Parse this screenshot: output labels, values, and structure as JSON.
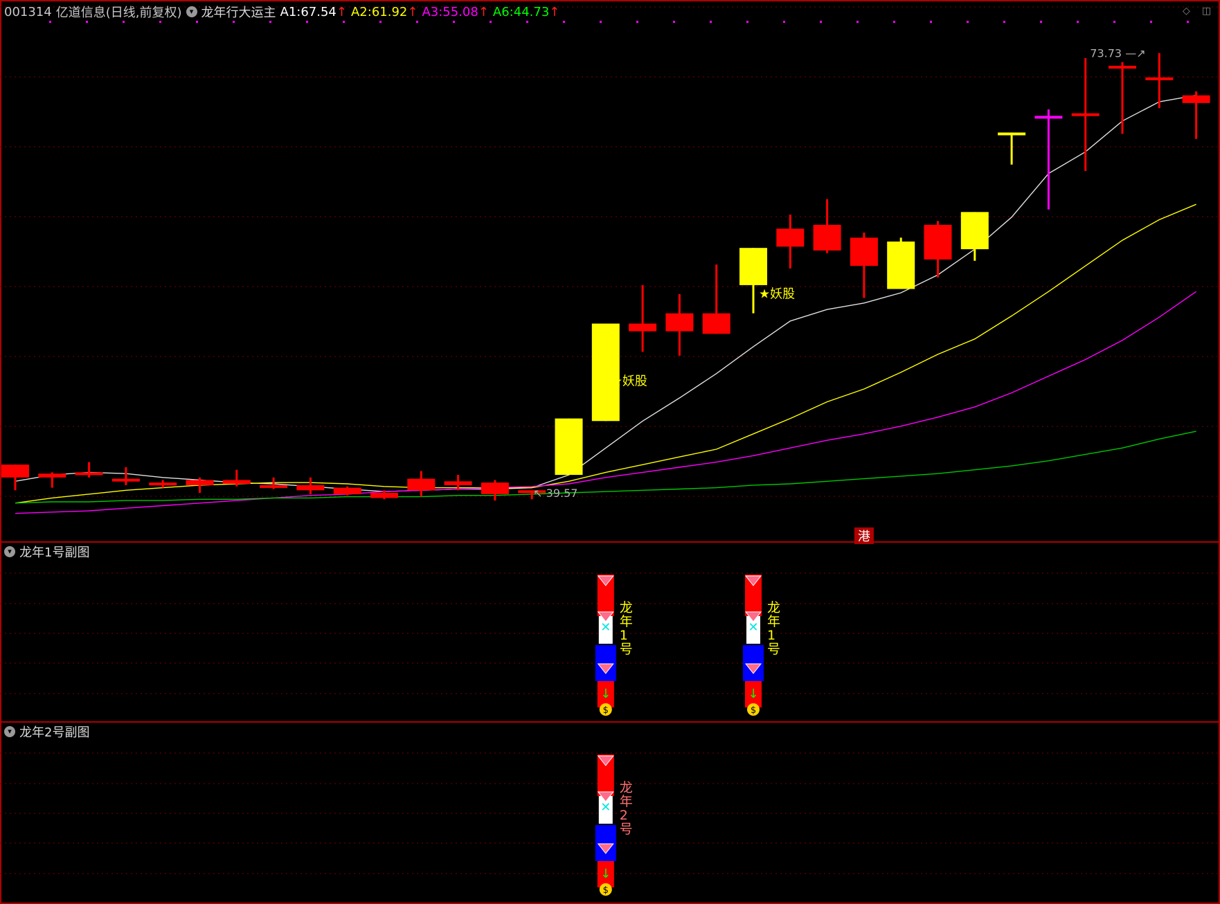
{
  "header": {
    "code": "001314",
    "name": "亿道信息(日线,前复权)",
    "indicator": "龙年行大运主",
    "ma_labels": [
      {
        "label": "A1:",
        "value": "67.54",
        "color": "#ffffff"
      },
      {
        "label": "A2:",
        "value": "61.92",
        "color": "#ffff00"
      },
      {
        "label": "A3:",
        "value": "55.08",
        "color": "#ff00ff"
      },
      {
        "label": "A6:",
        "value": "44.73",
        "color": "#00ff00"
      }
    ],
    "up_arrow": "↑"
  },
  "panes": {
    "sub1_title": "龙年1号副图",
    "sub2_title": "龙年2号副图",
    "sub1_glyphs": [
      "龙",
      "年",
      "1",
      "号"
    ],
    "sub2_glyphs": [
      "龙",
      "年",
      "2",
      "号"
    ]
  },
  "icons": [
    "chevron-down-icon",
    "diamond-icon",
    "window-icon",
    "gem-icon",
    "butterfly-icon",
    "arrow-down-icon",
    "money-bag-icon",
    "star-icon"
  ],
  "colors": {
    "up": "#ff0000",
    "down_yellow": "#ffff00",
    "magenta": "#ff00ff",
    "ma1": "#e0e0e0",
    "ma2": "#ffff00",
    "ma3": "#ff00ff",
    "ma6": "#00c800",
    "grid": "#7a0000",
    "frame": "#b00000",
    "sub_blue": "#0000ff"
  },
  "chart_data": {
    "type": "candlestick",
    "y_range_approx": [
      36,
      76
    ],
    "candles": [
      {
        "o": 40.6,
        "h": 41.2,
        "l": 39.6,
        "c": 41.6,
        "color": "red"
      },
      {
        "o": 40.9,
        "h": 41.0,
        "l": 39.8,
        "c": 40.6,
        "color": "red"
      },
      {
        "o": 41.0,
        "h": 41.8,
        "l": 40.6,
        "c": 40.8,
        "color": "red"
      },
      {
        "o": 40.5,
        "h": 41.4,
        "l": 40.0,
        "c": 40.3,
        "color": "red"
      },
      {
        "o": 40.2,
        "h": 40.4,
        "l": 39.8,
        "c": 40.0,
        "color": "red"
      },
      {
        "o": 40.4,
        "h": 40.6,
        "l": 39.4,
        "c": 40.0,
        "color": "red"
      },
      {
        "o": 40.4,
        "h": 41.2,
        "l": 39.9,
        "c": 40.1,
        "color": "red"
      },
      {
        "o": 40.0,
        "h": 40.6,
        "l": 39.7,
        "c": 39.8,
        "color": "red"
      },
      {
        "o": 40.0,
        "h": 40.6,
        "l": 39.3,
        "c": 39.6,
        "color": "red"
      },
      {
        "o": 39.8,
        "h": 39.9,
        "l": 39.2,
        "c": 39.3,
        "color": "red"
      },
      {
        "o": 39.4,
        "h": 39.6,
        "l": 38.9,
        "c": 39.0,
        "color": "red"
      },
      {
        "o": 39.6,
        "h": 41.1,
        "l": 39.1,
        "c": 40.5,
        "color": "red"
      },
      {
        "o": 40.0,
        "h": 40.8,
        "l": 39.6,
        "c": 40.3,
        "color": "red"
      },
      {
        "o": 40.2,
        "h": 40.4,
        "l": 38.8,
        "c": 39.3,
        "color": "red"
      },
      {
        "o": 39.5,
        "h": 39.6,
        "l": 38.9,
        "c": 39.6,
        "color": "red"
      },
      {
        "o": 40.8,
        "h": 45.2,
        "l": 40.8,
        "c": 45.2,
        "color": "yellow"
      },
      {
        "o": 45.0,
        "h": 52.6,
        "l": 45.0,
        "c": 52.6,
        "color": "yellow"
      },
      {
        "o": 52.6,
        "h": 55.6,
        "l": 50.4,
        "c": 52.0,
        "color": "red"
      },
      {
        "o": 53.4,
        "h": 54.9,
        "l": 50.1,
        "c": 52.0,
        "color": "red"
      },
      {
        "o": 53.4,
        "h": 57.2,
        "l": 51.8,
        "c": 51.8,
        "color": "red"
      },
      {
        "o": 55.6,
        "h": 56.7,
        "l": 53.4,
        "c": 58.5,
        "color": "yellow"
      },
      {
        "o": 60.0,
        "h": 61.1,
        "l": 56.9,
        "c": 58.6,
        "color": "red"
      },
      {
        "o": 60.3,
        "h": 62.3,
        "l": 58.1,
        "c": 58.3,
        "color": "red"
      },
      {
        "o": 57.1,
        "h": 59.7,
        "l": 54.6,
        "c": 59.3,
        "color": "red"
      },
      {
        "o": 59.0,
        "h": 59.3,
        "l": 55.3,
        "c": 55.3,
        "color": "yellow"
      },
      {
        "o": 57.6,
        "h": 60.6,
        "l": 56.2,
        "c": 60.3,
        "color": "red"
      },
      {
        "o": 58.4,
        "h": 58.0,
        "l": 57.5,
        "c": 61.3,
        "color": "yellow"
      },
      {
        "o": 67.5,
        "h": 66.9,
        "l": 65.0,
        "c": 67.5,
        "color": "yellow"
      },
      {
        "o": 68.8,
        "h": 69.3,
        "l": 61.5,
        "c": 68.6,
        "color": "magenta"
      },
      {
        "o": 69.0,
        "h": 73.3,
        "l": 64.5,
        "c": 69.0,
        "color": "red"
      },
      {
        "o": 72.7,
        "h": 73.0,
        "l": 67.4,
        "c": 72.7,
        "color": "red"
      },
      {
        "o": 71.8,
        "h": 73.7,
        "l": 69.4,
        "c": 71.8,
        "color": "red"
      },
      {
        "o": 69.8,
        "h": 70.7,
        "l": 67.0,
        "c": 70.4,
        "color": "red"
      }
    ],
    "ma_series": [
      {
        "name": "A1",
        "color": "#e0e0e0",
        "values": [
          40.3,
          40.8,
          41.0,
          40.9,
          40.6,
          40.4,
          40.2,
          40.1,
          39.9,
          39.7,
          39.5,
          39.6,
          39.7,
          39.7,
          39.8,
          40.8,
          42.9,
          45.0,
          46.8,
          48.7,
          50.8,
          52.8,
          53.7,
          54.2,
          55.0,
          56.4,
          58.4,
          60.9,
          64.3,
          66.0,
          68.4,
          69.9,
          70.4
        ]
      },
      {
        "name": "A2",
        "color": "#ffff00",
        "values": [
          38.6,
          39.0,
          39.3,
          39.6,
          39.8,
          40.0,
          40.1,
          40.2,
          40.2,
          40.1,
          39.9,
          39.8,
          39.8,
          39.8,
          39.8,
          40.3,
          41.0,
          41.6,
          42.2,
          42.8,
          44.0,
          45.2,
          46.5,
          47.5,
          48.8,
          50.2,
          51.4,
          53.2,
          55.1,
          57.1,
          59.1,
          60.7,
          61.9
        ]
      },
      {
        "name": "A3",
        "color": "#ff00ff",
        "values": [
          37.8,
          37.9,
          38.0,
          38.2,
          38.4,
          38.6,
          38.8,
          39.0,
          39.2,
          39.3,
          39.5,
          39.6,
          39.7,
          39.8,
          39.9,
          40.1,
          40.6,
          41.0,
          41.4,
          41.8,
          42.3,
          42.9,
          43.5,
          44.0,
          44.6,
          45.3,
          46.1,
          47.2,
          48.5,
          49.8,
          51.3,
          53.1,
          55.1
        ]
      },
      {
        "name": "A6",
        "color": "#00c800",
        "values": [
          38.6,
          38.7,
          38.7,
          38.8,
          38.8,
          38.9,
          38.9,
          39.0,
          39.0,
          39.1,
          39.1,
          39.1,
          39.2,
          39.2,
          39.3,
          39.4,
          39.5,
          39.6,
          39.7,
          39.8,
          40.0,
          40.1,
          40.3,
          40.5,
          40.7,
          40.9,
          41.2,
          41.5,
          41.9,
          42.4,
          42.9,
          43.6,
          44.2
        ]
      }
    ],
    "annotations": [
      {
        "text": "39.57",
        "at_candle": 14,
        "value": 39.4
      },
      {
        "text": "73.73",
        "at_candle": 31,
        "value": 73.7
      },
      {
        "text": "妖股",
        "at_candle": 16,
        "value": 47.8
      },
      {
        "text": "妖股",
        "at_candle": 20,
        "value": 54.6
      },
      {
        "text": "港",
        "at_candle": 23,
        "value": 35.9
      }
    ],
    "sub_signals": [
      {
        "pane": 1,
        "at_candle": 16
      },
      {
        "pane": 1,
        "at_candle": 20
      },
      {
        "pane": 2,
        "at_candle": 16
      }
    ]
  }
}
